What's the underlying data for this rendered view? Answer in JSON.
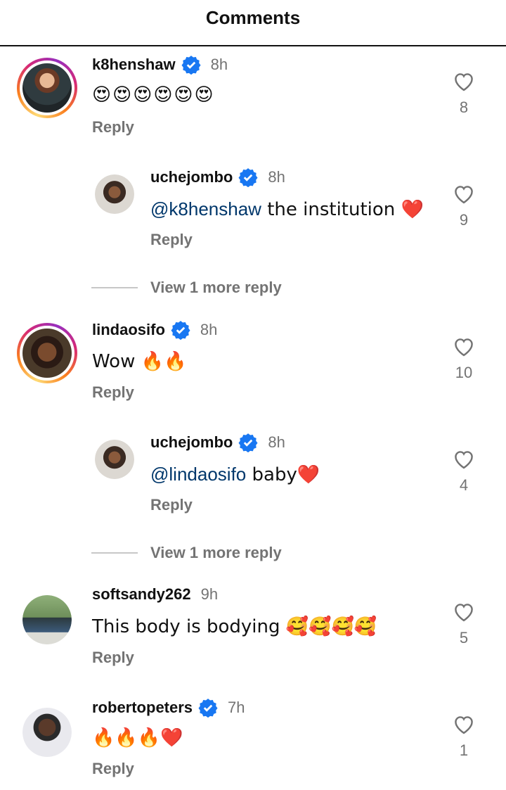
{
  "header": {
    "title": "Comments"
  },
  "comments": [
    {
      "user": "k8henshaw",
      "verified": true,
      "time": "8h",
      "text": "😍😍😍😍😍😍",
      "reply": "Reply",
      "likes": "8"
    },
    {
      "user": "uchejombo",
      "verified": true,
      "time": "8h",
      "mention": "@k8henshaw",
      "text": " the institution ❤️",
      "reply": "Reply",
      "likes": "9"
    },
    {
      "view_more": "View 1 more reply"
    },
    {
      "user": "lindaosifo",
      "verified": true,
      "time": "8h",
      "text": "Wow 🔥🔥",
      "reply": "Reply",
      "likes": "10"
    },
    {
      "user": "uchejombo",
      "verified": true,
      "time": "8h",
      "mention": "@lindaosifo",
      "text": " baby❤️",
      "reply": "Reply",
      "likes": "4"
    },
    {
      "view_more": "View 1 more reply"
    },
    {
      "user": "softsandy262",
      "verified": false,
      "time": "9h",
      "text": "This body is bodying 🥰🥰🥰🥰",
      "reply": "Reply",
      "likes": "5"
    },
    {
      "user": "robertopeters",
      "verified": true,
      "time": "7h",
      "text": "🔥🔥🔥❤️",
      "reply": "Reply",
      "likes": "1"
    }
  ],
  "colors": {
    "verified": "#1877f2",
    "mention": "#00376b",
    "muted": "#737373"
  }
}
